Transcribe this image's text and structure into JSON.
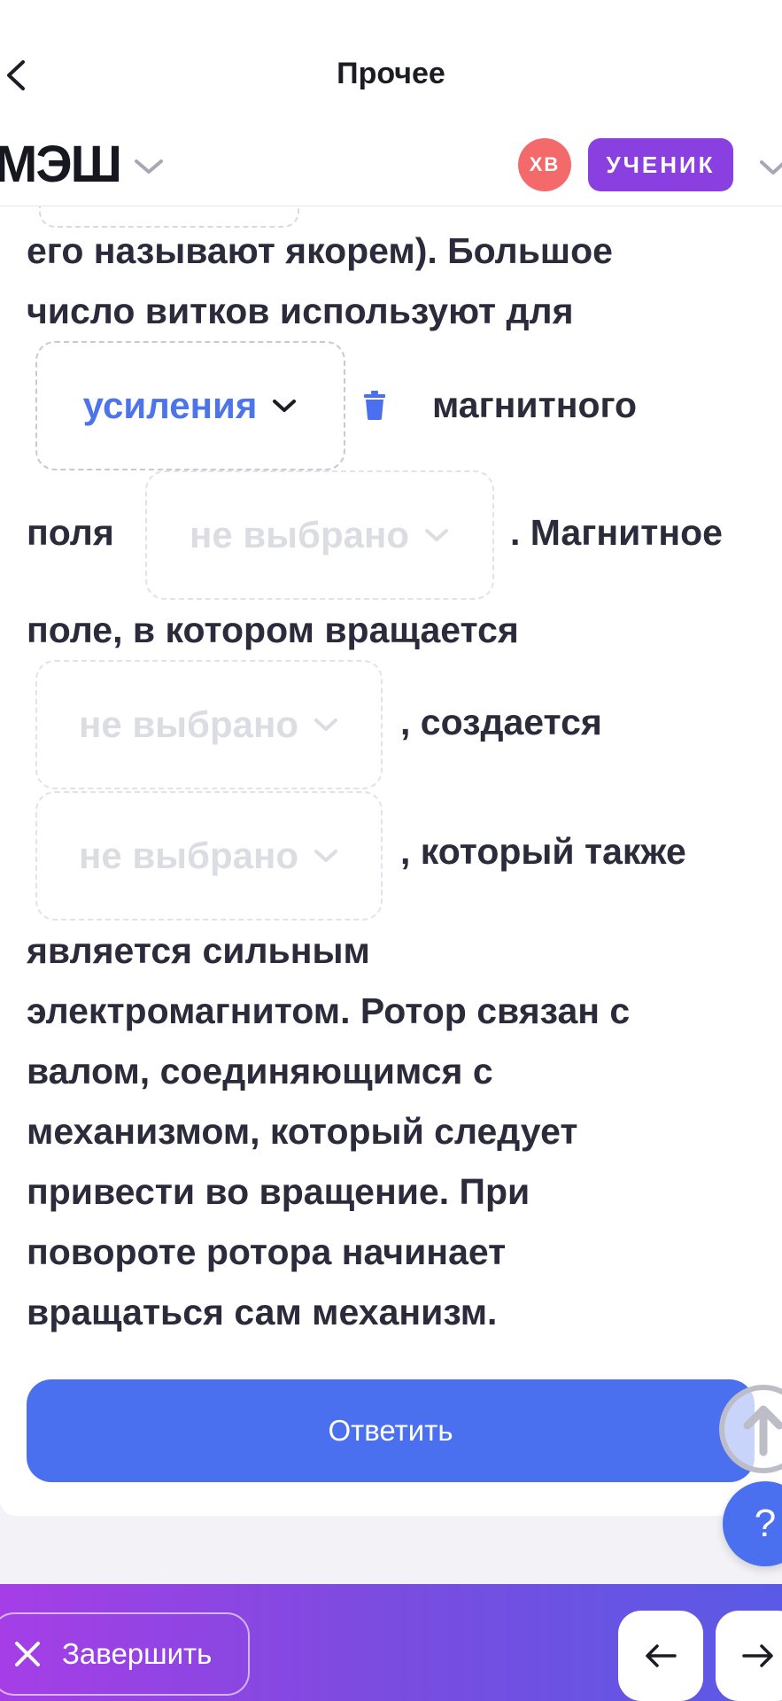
{
  "topbar": {
    "title": "Прочее"
  },
  "header": {
    "logo": "МЭШ",
    "avatar_initials": "ХВ",
    "role": "УЧЕНИК"
  },
  "task": {
    "line1": "его называют якорем). Большое",
    "line2": "число витков используют для",
    "dropdown1": {
      "value": "усиления",
      "state": "filled"
    },
    "after_dropdown1": "магнитного",
    "line_pole": "поля",
    "dropdown2": {
      "value": "не выбрано",
      "state": "empty"
    },
    "after_dropdown2": ". Магнитное",
    "line_field": "поле, в котором вращается",
    "dropdown3": {
      "value": "не выбрано",
      "state": "empty"
    },
    "after_dropdown3": ", создается",
    "dropdown4": {
      "value": "не выбрано",
      "state": "empty"
    },
    "after_dropdown4": ", который также",
    "paragraph_lines": [
      "является сильным",
      "электромагнитом. Ротор связан с",
      "валом, соединяющимся с",
      "механизмом, который следует",
      "привести во вращение. При",
      "повороте ротора начинает",
      "вращаться сам механизм."
    ]
  },
  "actions": {
    "answer_label": "Ответить",
    "help_label": "?"
  },
  "footer": {
    "finish_label": "Завершить"
  },
  "colors": {
    "accent": "#4a70ef",
    "role_badge": "#8a3fe0",
    "avatar": "#f46a6a",
    "filled_dropdown_text": "#4d74e9"
  }
}
